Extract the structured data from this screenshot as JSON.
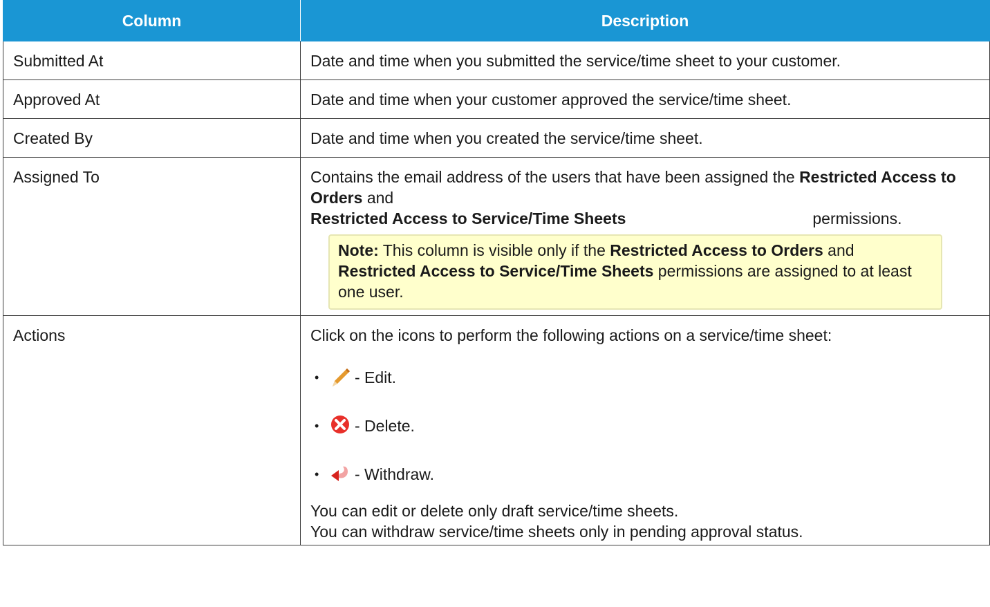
{
  "table": {
    "headers": [
      "Column",
      "Description"
    ],
    "rows": {
      "submitted_at": {
        "column": "Submitted At",
        "description": "Date and time when you submitted the service/time sheet to your customer."
      },
      "approved_at": {
        "column": "Approved At",
        "description": "Date and time when your customer approved the service/time sheet."
      },
      "created_by": {
        "column": "Created By",
        "description": "Date and time when you created the service/time sheet."
      },
      "assigned_to": {
        "column": "Assigned To",
        "desc_prefix": "Contains the email address of the users that have been assigned the ",
        "perm1": "Restricted Access to Orders",
        "and": " and ",
        "perm2": "Restricted Access to Service/Time Sheets",
        "desc_suffix": " permissions.",
        "note_label": "Note:",
        "note_prefix": " This column is visible only if the ",
        "note_perm1": "Restricted Access to Orders",
        "note_and": " and ",
        "note_perm2": "Restricted Access to Service/Time Sheets",
        "note_suffix": " permissions are assigned to at least one user."
      },
      "actions": {
        "column": "Actions",
        "intro": "Click on the icons to perform the following actions on a service/time sheet:",
        "items": [
          {
            "icon": "pencil-icon",
            "label": " - Edit."
          },
          {
            "icon": "delete-icon",
            "label": " - Delete."
          },
          {
            "icon": "withdraw-icon",
            "label": " - Withdraw."
          }
        ],
        "footer_line1": "You can edit or delete only draft service/time sheets.",
        "footer_line2": "You can withdraw service/time sheets only in pending approval status."
      }
    }
  },
  "colors": {
    "header_bg": "#1a96d4",
    "note_bg": "#ffffcc",
    "delete_red": "#e8302a",
    "pencil_orange": "#e59a2e"
  }
}
